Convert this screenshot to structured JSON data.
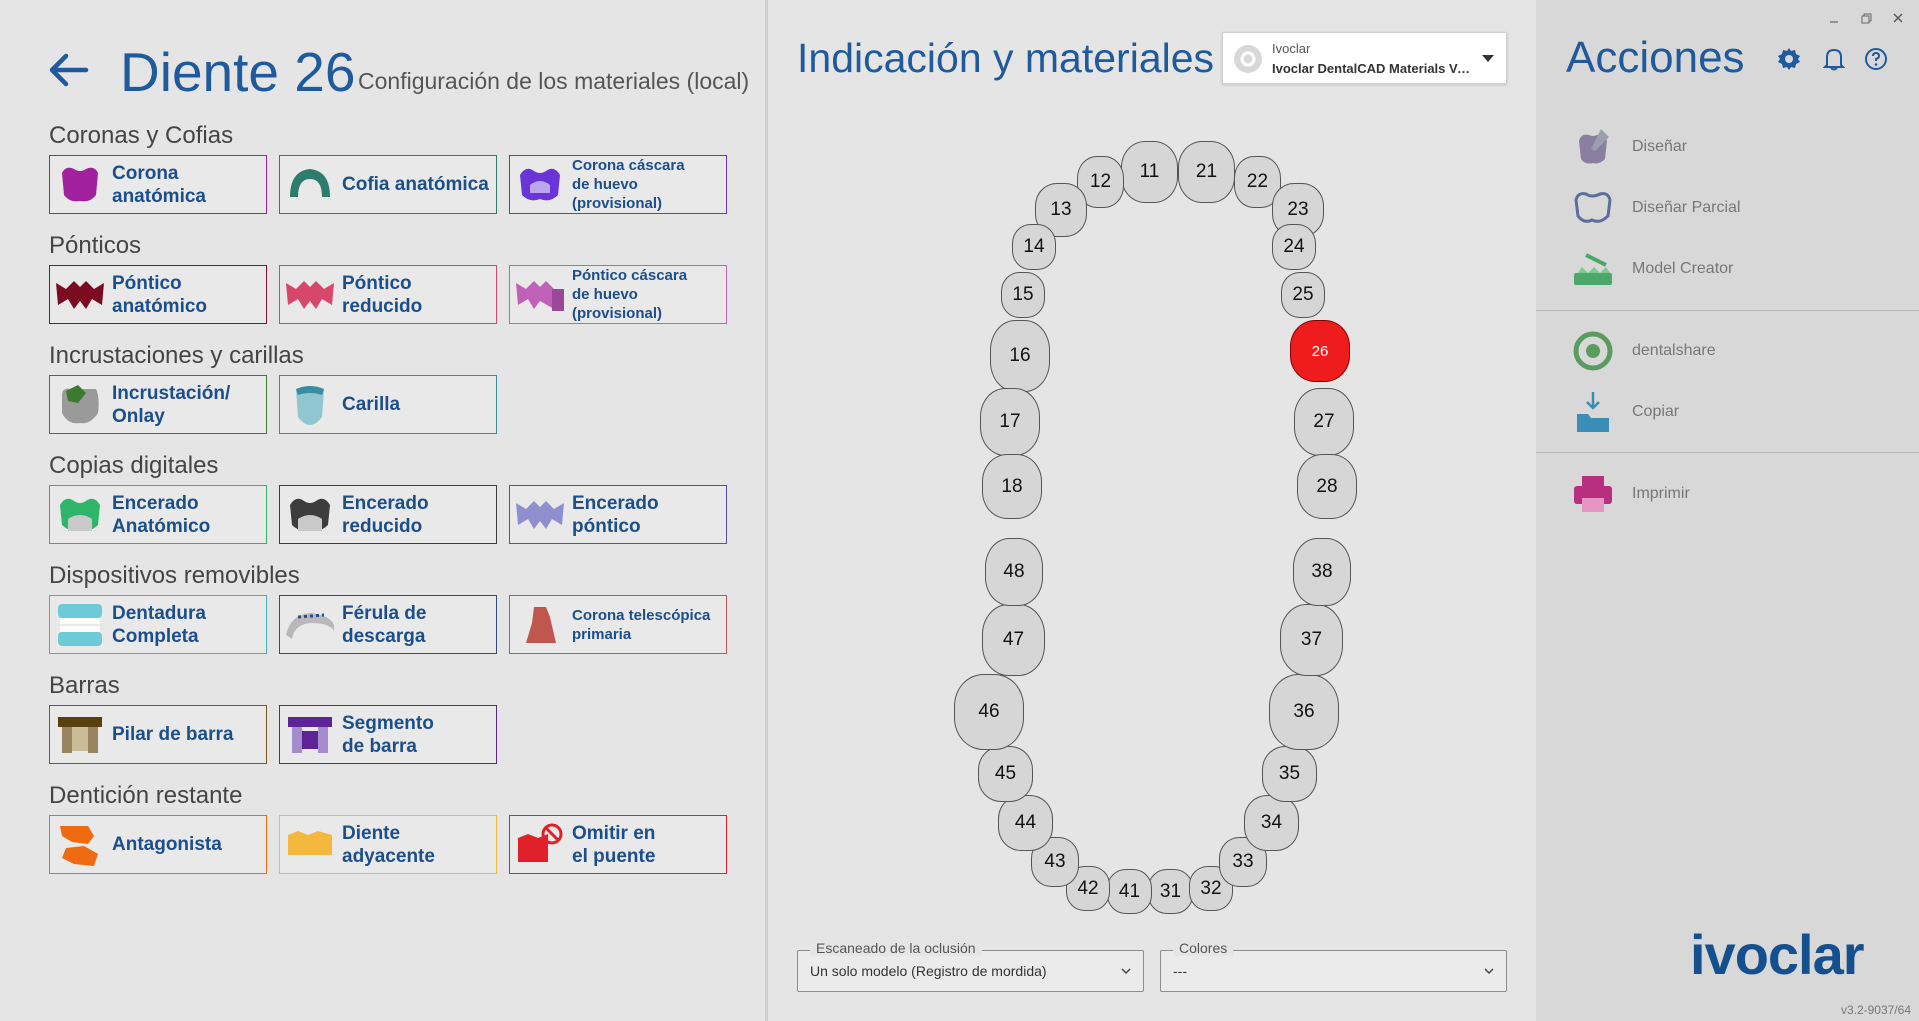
{
  "header": {
    "title": "Diente 26",
    "subtitle": "Configuración de los materiales (local)"
  },
  "sections": [
    {
      "title": "Coronas y Cofias",
      "cards": [
        {
          "label": "Corona\nanatómica",
          "icon": "corona-anatomica-icon",
          "color": "#a0209e"
        },
        {
          "label": "Cofia anatómica",
          "icon": "cofia-anatomica-icon",
          "color": "#2e7c6c"
        },
        {
          "label": "Corona cáscara\n de huevo\n     (provisional)",
          "icon": "corona-cascara-icon",
          "color": "#6a34d8"
        }
      ]
    },
    {
      "title": "Pónticos",
      "cards": [
        {
          "label": "Póntico\nanatómico",
          "icon": "pontico-anatomico-icon",
          "color": "#8a1028"
        },
        {
          "label": "Póntico reducido",
          "icon": "pontico-reducido-icon",
          "color": "#d6476a"
        },
        {
          "label": "Póntico cáscara\n de huevo\n     (provisional)",
          "icon": "pontico-cascara-icon",
          "color": "#c060b8"
        }
      ]
    },
    {
      "title": "Incrustaciones y carillas",
      "cards": [
        {
          "label": "Incrustación/\nOnlay",
          "icon": "incrustacion-icon",
          "color": "#3c7a30"
        },
        {
          "label": "Carilla",
          "icon": "carilla-icon",
          "color": "#3a8da0"
        }
      ]
    },
    {
      "title": "Copias digitales",
      "cards": [
        {
          "label": "Encerado\nAnatómico",
          "icon": "encerado-anatomico-icon",
          "color": "#2fb56a"
        },
        {
          "label": "Encerado\nreducido",
          "icon": "encerado-reducido-icon",
          "color": "#3d3d3d"
        },
        {
          "label": "Encerado\npóntico",
          "icon": "encerado-pontico-icon",
          "color": "#5b4ab0"
        }
      ]
    },
    {
      "title": "Dispositivos removibles",
      "cards": [
        {
          "label": "Dentadura\nCompleta",
          "icon": "dentadura-icon",
          "color": "#3fb4c8"
        },
        {
          "label": "Férula de\ndescarga",
          "icon": "ferula-icon",
          "color": "#2b4d88"
        },
        {
          "label": "Corona telescópica\nprimaria",
          "icon": "corona-telescopica-icon",
          "color": "#c0574e"
        }
      ]
    },
    {
      "title": "Barras",
      "cards": [
        {
          "label": "Pilar de barra",
          "icon": "pilar-barra-icon",
          "color": "#7a5a1c"
        },
        {
          "label": "Segmento\nde barra",
          "icon": "segmento-barra-icon",
          "color": "#5c2497"
        }
      ]
    },
    {
      "title": "Dentición restante",
      "cards": [
        {
          "label": "Antagonista",
          "icon": "antagonista-icon",
          "color": "#ef6a10"
        },
        {
          "label": "Diente\nadyacente",
          "icon": "diente-adyacente-icon",
          "color": "#f5b83e"
        },
        {
          "label": "Omitir en\nel puente",
          "icon": "omitir-puente-icon",
          "color": "#e0202a"
        }
      ]
    }
  ],
  "middle": {
    "title": "Indicación y materiales",
    "dropdown_title": "Ivoclar",
    "dropdown_value": "Ivoclar DentalCAD Materials Versi...",
    "selected_tooth": "26",
    "teeth": [
      "11",
      "12",
      "13",
      "14",
      "15",
      "16",
      "17",
      "18",
      "21",
      "22",
      "23",
      "24",
      "25",
      "26",
      "27",
      "28",
      "31",
      "32",
      "33",
      "34",
      "35",
      "36",
      "37",
      "38",
      "41",
      "42",
      "43",
      "44",
      "45",
      "46",
      "47",
      "48"
    ],
    "occlusion_label": "Escaneado de la oclusión",
    "occlusion_value": "Un solo modelo (Registro de mordida)",
    "colors_label": "Colores",
    "colors_value": "---"
  },
  "actions": {
    "title": "Acciones",
    "items": [
      {
        "label": "Diseñar",
        "icon": "design-tooth-icon"
      },
      {
        "label": "Diseñar Parcial",
        "icon": "partial-design-icon"
      },
      {
        "label": "Model Creator",
        "icon": "model-creator-icon"
      },
      {
        "label": "dentalshare",
        "icon": "dentalshare-icon"
      },
      {
        "label": "Copiar",
        "icon": "copy-folder-icon"
      },
      {
        "label": "Imprimir",
        "icon": "printer-icon"
      }
    ]
  },
  "brand": "ivoclar",
  "version": "v3.2-9037/64",
  "colors": {
    "title_blue": "#1f5a9c",
    "selected_tooth": "#ee1c1c",
    "label_blue": "#1c4f8a"
  }
}
